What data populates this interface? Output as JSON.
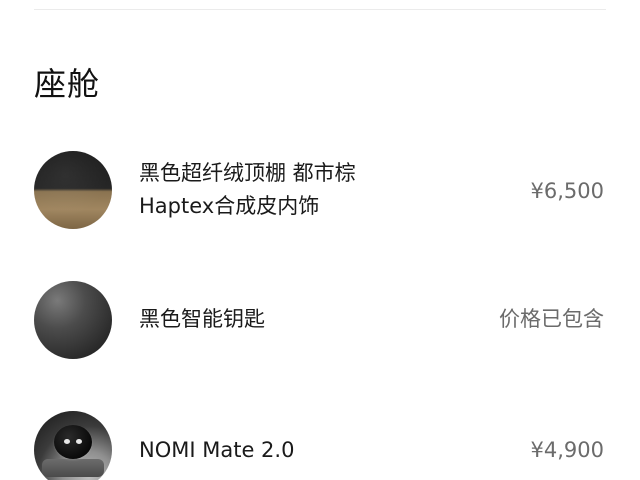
{
  "section": {
    "title": "座舱"
  },
  "items": [
    {
      "name_lines": [
        "黑色超纤绒顶棚 都市棕",
        "Haptex合成皮内饰"
      ],
      "price": "¥6,500",
      "thumbnail_icon": "interior-material-swatch"
    },
    {
      "name_lines": [
        "黑色智能钥匙"
      ],
      "price": "价格已包含",
      "thumbnail_icon": "smart-key-swatch"
    },
    {
      "name_lines": [
        "NOMI Mate 2.0"
      ],
      "price": "¥4,900",
      "thumbnail_icon": "nomi-robot"
    }
  ]
}
